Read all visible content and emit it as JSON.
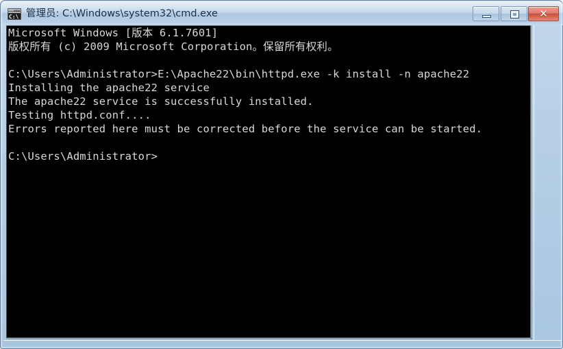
{
  "window": {
    "title": "管理员: C:\\Windows\\system32\\cmd.exe",
    "icon_name": "cmd-icon",
    "icon_text": "C:\\",
    "frame_color": "#b6cfe6",
    "titlebar_text_color": "#16314d"
  },
  "caption_buttons": {
    "minimize_label": "—",
    "maximize_label": "□",
    "close_label": "✕",
    "close_color": "#c8503c"
  },
  "console": {
    "background": "#000000",
    "foreground": "#d8d8d8",
    "lines": [
      "Microsoft Windows [版本 6.1.7601]",
      "版权所有 (c) 2009 Microsoft Corporation。保留所有权利。",
      "",
      "C:\\Users\\Administrator>E:\\Apache22\\bin\\httpd.exe -k install -n apache22",
      "Installing the apache22 service",
      "The apache22 service is successfully installed.",
      "Testing httpd.conf....",
      "Errors reported here must be corrected before the service can be started.",
      "",
      "C:\\Users\\Administrator>"
    ]
  }
}
